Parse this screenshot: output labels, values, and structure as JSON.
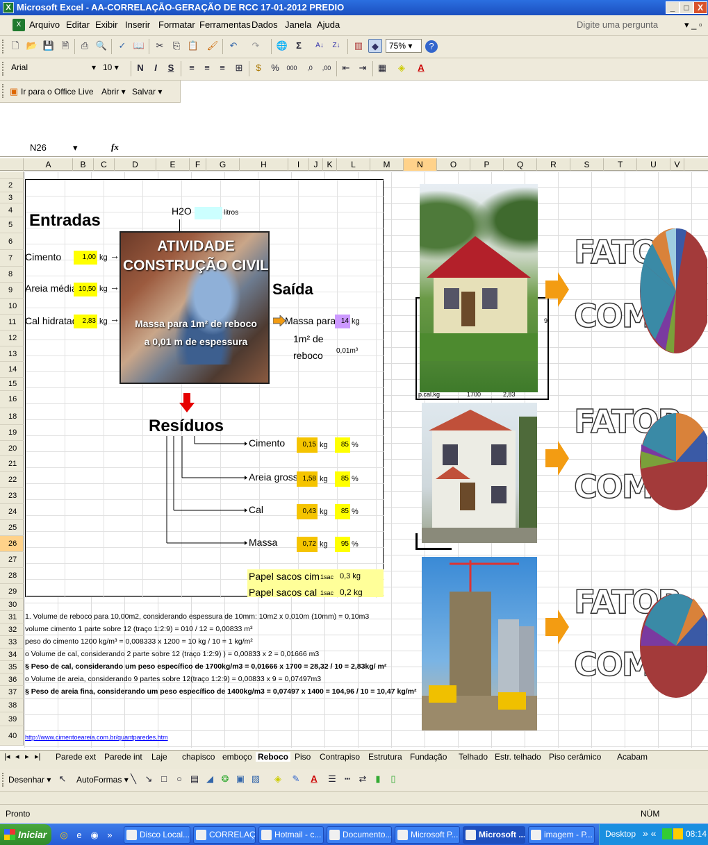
{
  "window": {
    "title": "Microsoft Excel - AA-CORRELAÇÃO-GERAÇÃO DE RCC 17-01-2012 PREDIO",
    "min": "_",
    "restore": "□",
    "close": "X"
  },
  "menu": {
    "items": [
      "Arquivo",
      "Editar",
      "Exibir",
      "Inserir",
      "Formatar",
      "Ferramentas",
      "Dados",
      "Janela",
      "Ajuda"
    ],
    "help_placeholder": "Digite uma pergunta"
  },
  "toolbar": {
    "zoom": "75%"
  },
  "format": {
    "font": "Arial",
    "size": "10",
    "bold": "N",
    "italic": "I",
    "underline": "S"
  },
  "weblive": {
    "office_live": "Ir para o Office Live",
    "open": "Abrir",
    "save": "Salvar"
  },
  "formula": {
    "name_box": "N26",
    "fx": "fx",
    "value": ""
  },
  "columns": [
    "A",
    "B",
    "C",
    "D",
    "E",
    "F",
    "G",
    "H",
    "I",
    "J",
    "K",
    "L",
    "M",
    "N",
    "O",
    "P",
    "Q",
    "R",
    "S",
    "T",
    "U",
    "V"
  ],
  "rows": [
    "2",
    "3",
    "4",
    "5",
    "6",
    "7",
    "8",
    "9",
    "10",
    "11",
    "12",
    "13",
    "14",
    "15",
    "16",
    "18",
    "19",
    "20",
    "21",
    "22",
    "23",
    "24",
    "25",
    "26",
    "27",
    "28",
    "29",
    "30",
    "31",
    "32",
    "33",
    "34",
    "35",
    "36",
    "37",
    "38",
    "39",
    "40"
  ],
  "sheet": {
    "entradas": "Entradas",
    "h2o": "H2O",
    "h2o_unit": "litros",
    "cimento_label": "Cimento",
    "cimento_val": "1,00",
    "cimento_unit": "kg",
    "areia_label": "Areia média",
    "areia_val": "10,50",
    "areia_unit": "kg",
    "cal_label": "Cal hidratado",
    "cal_val": "2,83",
    "cal_unit": "kg",
    "activity_title": "ATIVIDADE CONSTRUÇÃO CIVIL",
    "activity_sub": "Massa para 1m² de reboco a 0,01 m de espessura",
    "saida": "Saída",
    "massa_para": "Massa para",
    "massa_val": "14",
    "massa_unit": "kg",
    "m2_de": "1m² de",
    "reboco": "reboco",
    "espessura": "0,01m³",
    "residuos": "Resíduos",
    "res": [
      {
        "label": "Cimento",
        "val": "0,15",
        "unit": "kg",
        "pct": "85",
        "pu": "%"
      },
      {
        "label": "Areia grossa",
        "val": "1,58",
        "unit": "kg",
        "pct": "85",
        "pu": "%"
      },
      {
        "label": "Cal",
        "val": "0,43",
        "unit": "kg",
        "pct": "85",
        "pu": "%"
      },
      {
        "label": "Massa",
        "val": "0,72",
        "unit": "kg",
        "pct": "95",
        "pu": "%"
      }
    ],
    "papel_cim": "Papel sacos cim",
    "papel_cim_q": "1sac",
    "papel_cim_v": "0,3 kg",
    "papel_cal": "Papel sacos cal",
    "papel_cal_q": "1sac",
    "papel_cal_v": "0,2 kg",
    "hidden_a": "p.cal.kg",
    "hidden_b": "1700",
    "hidden_c": "2,83",
    "hidden_d": "9",
    "notes": [
      "1.      Volume de reboco para 10,00m2, considerando espessura de 10mm: 10m2 x 0,010m (10mm) = 0,10m3",
      "volume cimento 1 parte sobre 12 (traço 1:2:9) = 010 / 12 = 0,00833 m³",
      "peso do cimento 1200 kg/m³ = 0,008333 x 1200 =  10 kg / 10 = 1 kg/m²",
      "o    Volume de cal, considerando 2 parte sobre 12 (traço 1:2:9) ) = 0,00833 x 2 = 0,01666 m3",
      "§  Peso de cal, considerando um peso específico de 1700kg/m3 = 0,01666 x 1700 = 28,32  / 10 =  2,83kg/ m²",
      "o    Volume de areia, considerando 9 partes sobre 12(traço 1:2:9) = 0,00833 x 9 = 0,07497m3",
      "§  Peso de areia fina, considerando um peso específico de 1400kg/m3 = 0,07497 x 1400 = 104,96 / 10 =  10,47 kg/m²"
    ],
    "link": "http://www.cimentoeareia.com.br/quantparedes.htm",
    "fator": "FATOR",
    "comp": "COMP."
  },
  "tabs": [
    "Parede ext",
    "Parede int",
    "Laje",
    "chapisco",
    "emboço",
    "Reboco",
    "Piso",
    "Contrapiso",
    "Estrutura",
    "Fundação",
    "Telhado",
    "Estr. telhado",
    "Piso cerâmico",
    "Acabam"
  ],
  "drawing": {
    "draw": "Desenhar",
    "autoshapes": "AutoFormas"
  },
  "status": {
    "left": "Pronto",
    "num": "NÚM"
  },
  "taskbar": {
    "start": "Iniciar",
    "items": [
      "Disco Local...",
      "CORRELAÇ...",
      "Hotmail - c...",
      "Documento...",
      "Microsoft P...",
      "Microsoft ...",
      "imagem - P..."
    ],
    "desktop": "Desktop",
    "time": "08:14"
  },
  "colors": {
    "yellow": "#ffff00",
    "orange": "#f5c400",
    "purple": "#cc99ff",
    "cyan": "#ccffff",
    "lightyellow": "#ffff99"
  }
}
